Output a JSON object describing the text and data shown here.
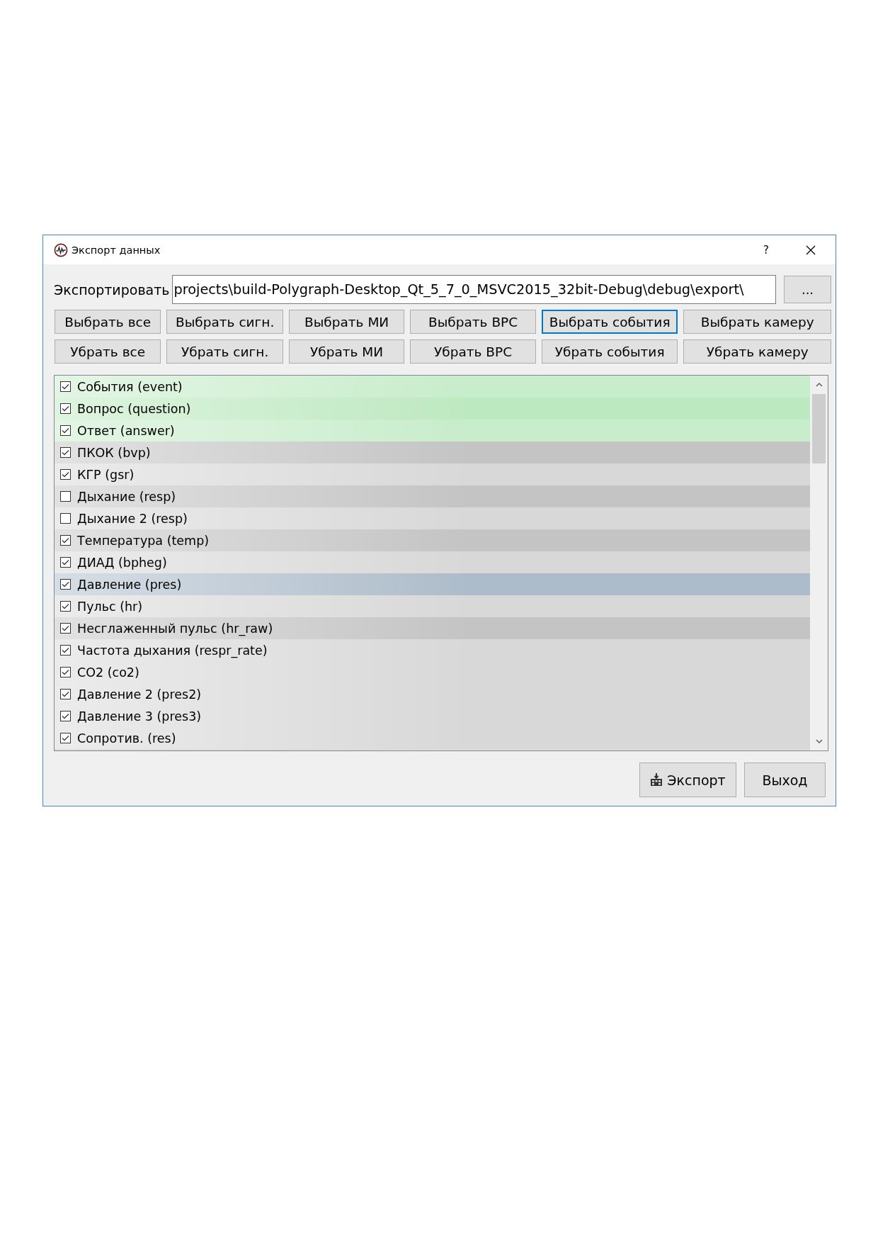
{
  "window": {
    "title": "Экспорт данных",
    "help_button": "?"
  },
  "export_path": {
    "label": "Экспортировать",
    "value": "projects\\build-Polygraph-Desktop_Qt_5_7_0_MSVC2015_32bit-Debug\\debug\\export\\",
    "browse_button": "..."
  },
  "select_buttons": [
    {
      "label": "Выбрать все",
      "focused": false
    },
    {
      "label": "Выбрать сигн.",
      "focused": false
    },
    {
      "label": "Выбрать МИ",
      "focused": false
    },
    {
      "label": "Выбрать ВРС",
      "focused": false
    },
    {
      "label": "Выбрать события",
      "focused": true
    },
    {
      "label": "Выбрать камеру",
      "focused": false
    }
  ],
  "deselect_buttons": [
    {
      "label": "Убрать все",
      "focused": false
    },
    {
      "label": "Убрать сигн.",
      "focused": false
    },
    {
      "label": "Убрать МИ",
      "focused": false
    },
    {
      "label": "Убрать ВРС",
      "focused": false
    },
    {
      "label": "Убрать события",
      "focused": false
    },
    {
      "label": "Убрать камеру",
      "focused": false
    }
  ],
  "channels": [
    {
      "label": "События (event)",
      "checked": true,
      "selected": false,
      "color": "#c8edcb"
    },
    {
      "label": "Вопрос (question)",
      "checked": true,
      "selected": false,
      "color": "#bde9c0"
    },
    {
      "label": "Ответ (answer)",
      "checked": true,
      "selected": false,
      "color": "#c8edcb"
    },
    {
      "label": "ПКОК (bvp)",
      "checked": true,
      "selected": false,
      "color": "#c4c4c4"
    },
    {
      "label": "КГР (gsr)",
      "checked": true,
      "selected": false,
      "color": "#d8d8d8"
    },
    {
      "label": "Дыхание (resp)",
      "checked": false,
      "selected": false,
      "color": "#c4c4c4"
    },
    {
      "label": "Дыхание 2 (resp)",
      "checked": false,
      "selected": false,
      "color": "#d8d8d8"
    },
    {
      "label": "Температура (temp)",
      "checked": true,
      "selected": false,
      "color": "#c4c4c4"
    },
    {
      "label": "ДИАД (bpheg)",
      "checked": true,
      "selected": false,
      "color": "#d8d8d8"
    },
    {
      "label": "Давление (pres)",
      "checked": true,
      "selected": true
    },
    {
      "label": "Пульс (hr)",
      "checked": true,
      "selected": false,
      "color": "#d8d8d8"
    },
    {
      "label": "Несглаженный пульс (hr_raw)",
      "checked": true,
      "selected": false,
      "color": "#c4c4c4"
    },
    {
      "label": "Частота дыхания (respr_rate)",
      "checked": true,
      "selected": false,
      "color": "#d8d8d8"
    },
    {
      "label": "CO2 (co2)",
      "checked": true,
      "selected": false,
      "color": "#d8d8d8"
    },
    {
      "label": "Давление 2 (pres2)",
      "checked": true,
      "selected": false,
      "color": "#d8d8d8"
    },
    {
      "label": "Давление 3 (pres3)",
      "checked": true,
      "selected": false,
      "color": "#d8d8d8"
    },
    {
      "label": "Сопротив. (res)",
      "checked": true,
      "selected": false,
      "color": "#d8d8d8"
    }
  ],
  "footer_buttons": [
    {
      "label": "Экспорт",
      "kind": "export"
    },
    {
      "label": "Выход",
      "kind": "plain"
    }
  ]
}
